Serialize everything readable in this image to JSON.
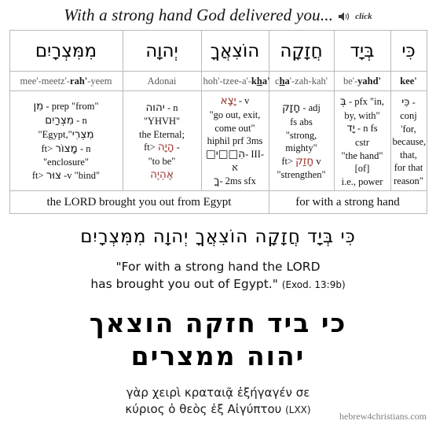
{
  "header": {
    "title": "With a strong hand God delivered you...",
    "audio_icon": "speaker-icon",
    "click_label": "click"
  },
  "table": {
    "hebrew_words": [
      "מִמִּצְרָיִם",
      "יְהוָה",
      "הוֹצִאֲךָ",
      "חֲזָקָה",
      "בְּיָד",
      "כִּי"
    ],
    "transliterations": [
      {
        "pre": "mee'-meetz'-",
        "bold": "rah'",
        "post": "-yeem"
      },
      {
        "pre": "Adonai",
        "bold": "",
        "post": ""
      },
      {
        "pre": "hoh'-tzee-a'-",
        "bold": "kha'",
        "post": "",
        "underline_in_bold": "h"
      },
      {
        "pre": "c",
        "bold": "ha",
        "post": "'-zah-kah'",
        "underline_in_bold": "h"
      },
      {
        "pre": "be'-",
        "bold": "yahd'",
        "post": ""
      },
      {
        "pre": "",
        "bold": "kee'",
        "post": ""
      }
    ],
    "parsing": [
      {
        "lines": [
          {
            "heb": "מִן",
            "heb_color": "black",
            "text": " - prep \"from\""
          },
          {
            "heb": "מִצְרַיִם",
            "heb_color": "black",
            "text": " - n"
          },
          {
            "heb": "מִצְרִי",
            "heb_color": "black",
            "text": " \"Egypt,\"",
            "order": "text_first"
          },
          {
            "heb": "מָצוֹר",
            "heb_color": "black",
            "text": " - n",
            "prefix": "ft>"
          },
          {
            "heb": "",
            "heb_color": "black",
            "text": "\"enclosure\""
          },
          {
            "heb": "צוּר",
            "heb_color": "black",
            "text": " -v \"bind\"",
            "prefix": "ft>"
          }
        ]
      },
      {
        "lines": [
          {
            "heb": "יהוה",
            "heb_color": "black",
            "text": " - n"
          },
          {
            "heb": "",
            "heb_color": "black",
            "text": "\"YHVH\""
          },
          {
            "heb": "",
            "heb_color": "black",
            "text": "the Eternal;"
          },
          {
            "heb": "הָיָה",
            "heb_color": "red",
            "text": " -",
            "prefix": "ft>"
          },
          {
            "heb": "",
            "heb_color": "black",
            "text": "\"to be\""
          },
          {
            "heb": "אֶהְיֶה",
            "heb_color": "red",
            "text": ""
          }
        ]
      },
      {
        "lines": [
          {
            "heb": "יָצָא",
            "heb_color": "red",
            "text": " - v"
          },
          {
            "heb": "",
            "heb_color": "black",
            "text": "\"go out, exit,"
          },
          {
            "heb": "",
            "heb_color": "black",
            "text": "come out\""
          },
          {
            "heb": "",
            "heb_color": "black",
            "text": "hiphil prf 3ms"
          },
          {
            "heb": "הִ□□ִי□",
            "heb_color": "black",
            "text": "- III-א"
          },
          {
            "heb": "ךָ",
            "heb_color": "black",
            "text": "- 2ms sfx"
          }
        ]
      },
      {
        "lines": [
          {
            "heb": "חָזָק",
            "heb_color": "black",
            "text": " - adj"
          },
          {
            "heb": "",
            "heb_color": "black",
            "text": "fs abs"
          },
          {
            "heb": "",
            "heb_color": "black",
            "text": "\"strong,"
          },
          {
            "heb": "",
            "heb_color": "black",
            "text": "mighty\""
          },
          {
            "heb": "חָזַק",
            "heb_color": "red",
            "text": " v",
            "prefix": "ft>"
          },
          {
            "heb": "",
            "heb_color": "black",
            "text": "\"strengthen\""
          }
        ]
      },
      {
        "lines": [
          {
            "heb": "בְּ",
            "heb_color": "black",
            "text": " - pfx \"in,"
          },
          {
            "heb": "",
            "heb_color": "black",
            "text": "by, with\""
          },
          {
            "heb": "יָד",
            "heb_color": "black",
            "text": " - n fs"
          },
          {
            "heb": "",
            "heb_color": "black",
            "text": "cstr"
          },
          {
            "heb": "",
            "heb_color": "black",
            "text": "\"the hand\""
          },
          {
            "heb": "",
            "heb_color": "black",
            "text": "[of]"
          },
          {
            "heb": "",
            "heb_color": "black",
            "text": "i.e., power"
          }
        ]
      },
      {
        "lines": [
          {
            "heb": "כִּי",
            "heb_color": "black",
            "text": " - conj"
          },
          {
            "heb": "",
            "heb_color": "black",
            "text": "'for,"
          },
          {
            "heb": "",
            "heb_color": "black",
            "text": "because,"
          },
          {
            "heb": "",
            "heb_color": "black",
            "text": "that,"
          },
          {
            "heb": "",
            "heb_color": "black",
            "text": "for that"
          },
          {
            "heb": "",
            "heb_color": "black",
            "text": "reason\""
          }
        ]
      }
    ],
    "gloss_left": "the LORD brought you out from Egypt",
    "gloss_right": "for with a strong hand"
  },
  "verse_pointed": "כִּי בְּיָד חֲזָקָה הוֹצִאֲךָ יְהוָה מִמִּצְרָיִם",
  "translation": {
    "line1": "\"For with a strong hand the LORD",
    "line2": "has brought you out of Egypt.\"",
    "reference": "(Exod. 13:9b)"
  },
  "verse_big": {
    "line1": "כי ביד חזקה הוצאך",
    "line2": "יהוה ממצרים"
  },
  "greek": {
    "line1": "γὰρ χειρὶ κραταιᾷ ἐξήγαγέν σε",
    "line2": "κύριος ὁ θεὸς ἐξ Αἰγύπτου",
    "source": "(LXX)"
  },
  "footer": "hebrew4christians.com",
  "colors": {
    "hebrew_accent": "#99322a",
    "border": "#b9b9b9",
    "translit": "#585858",
    "footer": "#808080"
  }
}
